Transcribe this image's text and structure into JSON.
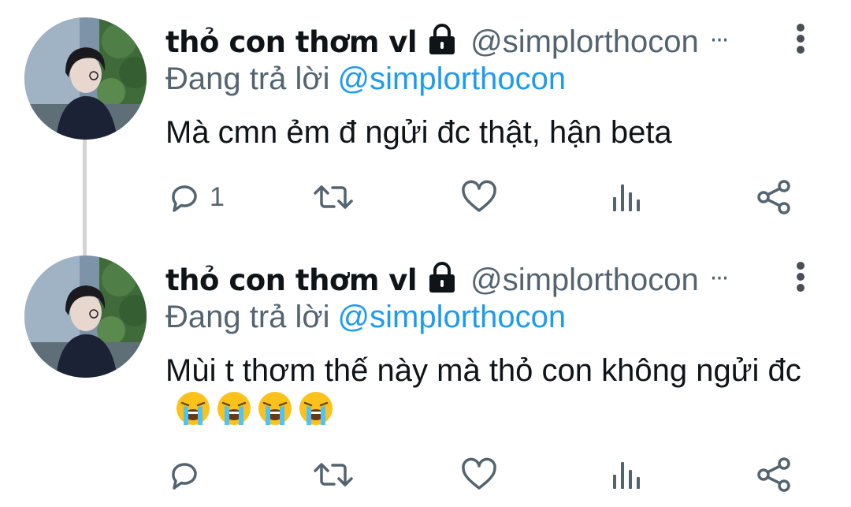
{
  "tweets": [
    {
      "display_name": "thỏ con thơm vl",
      "handle": "@simplorthocon",
      "more_glyph": "···",
      "replying_to_label": "Đang trả lời",
      "replying_to_handle": "@simplorthocon",
      "text": "Mà cmn ẻm đ ngửi đc thật, hận beta",
      "emojis": [],
      "reply_count": "1",
      "icons": [
        "lock-icon",
        "reply-icon",
        "retweet-icon",
        "like-icon",
        "views-icon",
        "share-icon",
        "more-vertical-icon"
      ]
    },
    {
      "display_name": "thỏ con thơm vl",
      "handle": "@simplorthocon",
      "more_glyph": "···",
      "replying_to_label": "Đang trả lời",
      "replying_to_handle": "@simplorthocon",
      "text": "Mùi t thơm thế này mà thỏ con không ngửi đc",
      "emojis": [
        "crying-face",
        "crying-face",
        "crying-face",
        "crying-face"
      ],
      "reply_count": "",
      "icons": [
        "lock-icon",
        "reply-icon",
        "retweet-icon",
        "like-icon",
        "views-icon",
        "share-icon",
        "more-vertical-icon"
      ]
    }
  ],
  "colors": {
    "name": "#0f1419",
    "secondary": "#536471",
    "mention": "#1d9bf0",
    "thread_line": "#d4d4d4",
    "icon": "#536471"
  }
}
